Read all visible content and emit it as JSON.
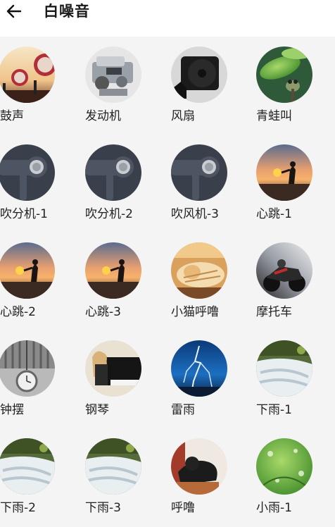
{
  "header": {
    "back_icon": "arrow-left-icon",
    "title": "白噪音"
  },
  "sounds": [
    {
      "label": "鼓声",
      "icon": "drum-image"
    },
    {
      "label": "发动机",
      "icon": "engine-image"
    },
    {
      "label": "风扇",
      "icon": "fan-image"
    },
    {
      "label": "青蛙叫",
      "icon": "frog-image"
    },
    {
      "label": "吹分机-1",
      "icon": "hair-dryer-image"
    },
    {
      "label": "吹分机-2",
      "icon": "hair-dryer-image"
    },
    {
      "label": "吹风机-3",
      "icon": "hair-dryer-image"
    },
    {
      "label": "心跳-1",
      "icon": "sunset-silhouette-image"
    },
    {
      "label": "心跳-2",
      "icon": "sunset-silhouette-image"
    },
    {
      "label": "心跳-3",
      "icon": "sunset-silhouette-image"
    },
    {
      "label": "小猫呼噜",
      "icon": "cat-image"
    },
    {
      "label": "摩托车",
      "icon": "motorcycle-image"
    },
    {
      "label": "钟摆",
      "icon": "pocket-watch-image"
    },
    {
      "label": "钢琴",
      "icon": "piano-image"
    },
    {
      "label": "雷雨",
      "icon": "lightning-image"
    },
    {
      "label": "下雨-1",
      "icon": "waterfall-image"
    },
    {
      "label": "下雨-2",
      "icon": "waterfall-image"
    },
    {
      "label": "下雨-3",
      "icon": "waterfall-image"
    },
    {
      "label": "呼噜",
      "icon": "dog-image"
    },
    {
      "label": "小雨-1",
      "icon": "raindrop-leaf-image"
    }
  ]
}
